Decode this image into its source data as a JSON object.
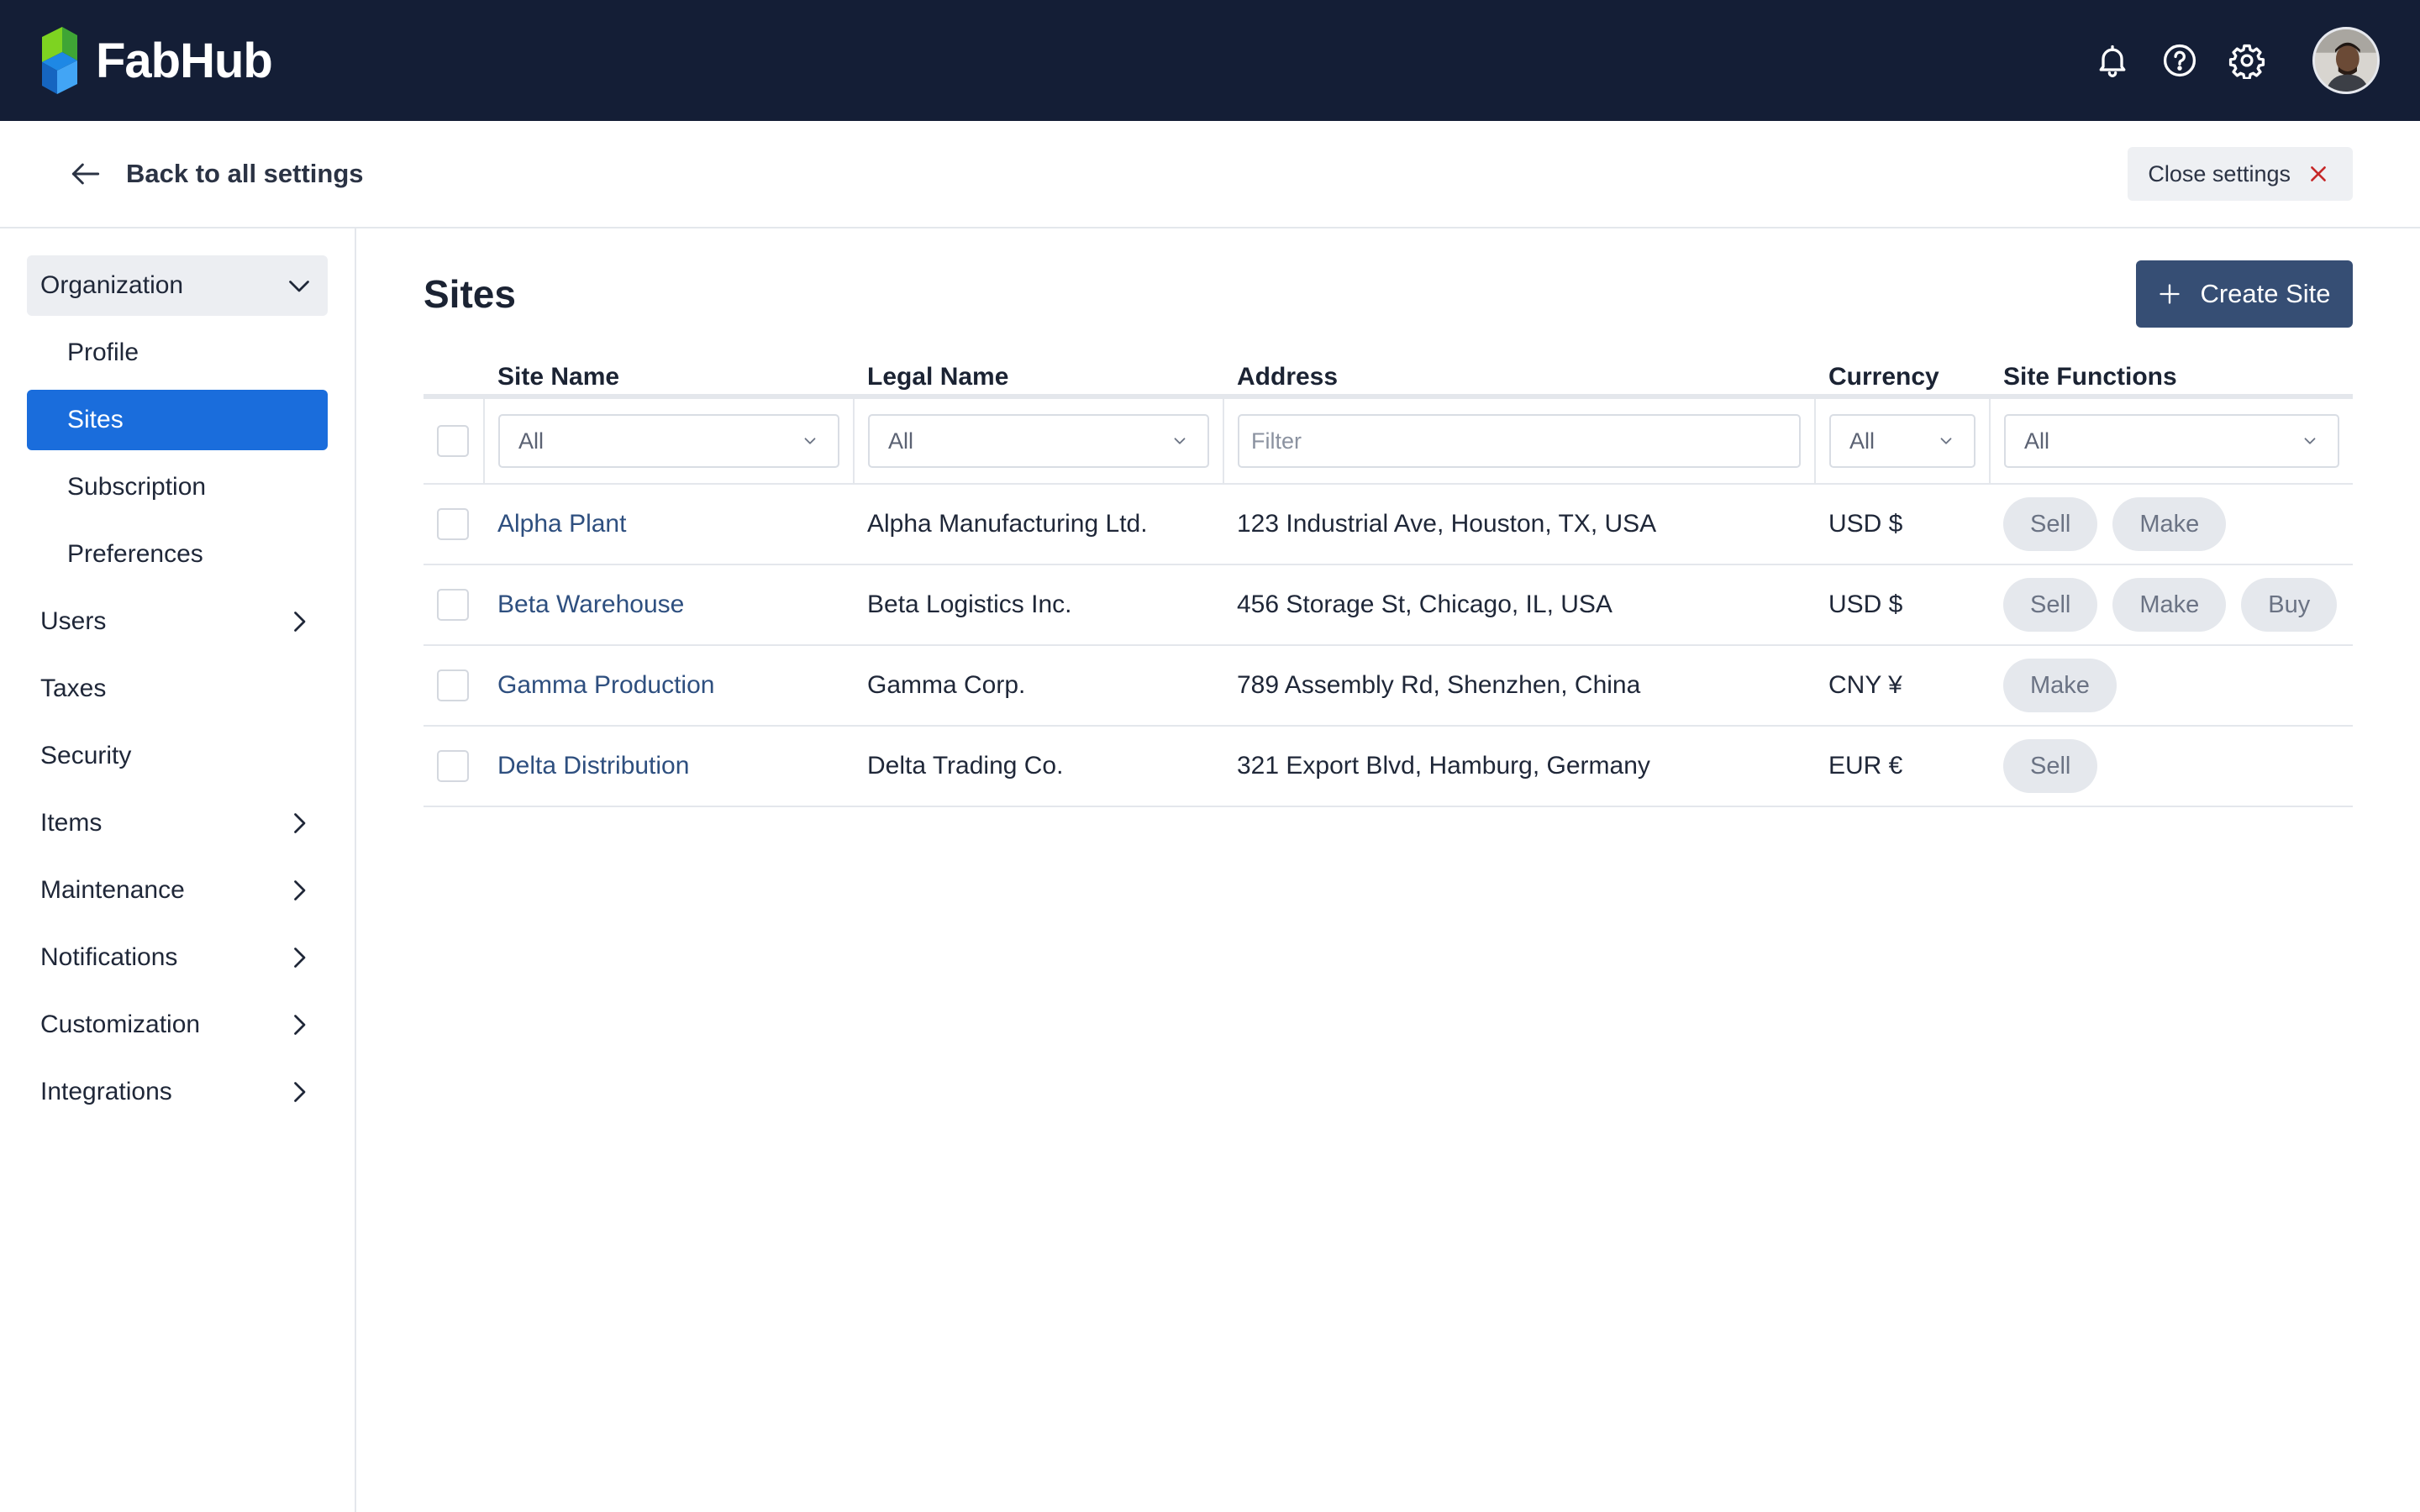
{
  "app": {
    "name": "FabHub"
  },
  "topbar": {
    "icons": [
      "bell-icon",
      "help-icon",
      "gear-icon"
    ],
    "avatar": "user-avatar"
  },
  "subheader": {
    "back_label": "Back to all settings",
    "close_label": "Close settings"
  },
  "sidebar": {
    "items": [
      {
        "label": "Organization",
        "type": "group",
        "chevron": "down"
      },
      {
        "label": "Profile",
        "type": "sub"
      },
      {
        "label": "Sites",
        "type": "sub",
        "active": true
      },
      {
        "label": "Subscription",
        "type": "sub"
      },
      {
        "label": "Preferences",
        "type": "sub"
      },
      {
        "label": "Users",
        "chevron": "right"
      },
      {
        "label": "Taxes"
      },
      {
        "label": "Security"
      },
      {
        "label": "Items",
        "chevron": "right"
      },
      {
        "label": "Maintenance",
        "chevron": "right"
      },
      {
        "label": "Notifications",
        "chevron": "right"
      },
      {
        "label": "Customization",
        "chevron": "right"
      },
      {
        "label": "Integrations",
        "chevron": "right"
      }
    ]
  },
  "main": {
    "title": "Sites",
    "create_label": "Create Site",
    "columns": [
      "Site Name",
      "Legal Name",
      "Address",
      "Currency",
      "Site Functions"
    ],
    "filters": {
      "site_name": "All",
      "legal_name": "All",
      "address_placeholder": "Filter",
      "currency": "All",
      "site_functions": "All"
    },
    "rows": [
      {
        "site_name": "Alpha Plant",
        "legal_name": "Alpha Manufacturing Ltd.",
        "address": "123 Industrial Ave, Houston, TX, USA",
        "currency": "USD $",
        "functions": [
          "Sell",
          "Make"
        ]
      },
      {
        "site_name": "Beta Warehouse",
        "legal_name": "Beta Logistics Inc.",
        "address": "456 Storage St, Chicago, IL, USA",
        "currency": "USD $",
        "functions": [
          "Sell",
          "Make",
          "Buy"
        ]
      },
      {
        "site_name": "Gamma Production",
        "legal_name": "Gamma Corp.",
        "address": "789 Assembly Rd, Shenzhen, China",
        "currency": "CNY ¥",
        "functions": [
          "Make"
        ]
      },
      {
        "site_name": "Delta Distribution",
        "legal_name": "Delta Trading Co.",
        "address": "321 Export Blvd, Hamburg, Germany",
        "currency": "EUR €",
        "functions": [
          "Sell"
        ]
      }
    ]
  },
  "colors": {
    "topbar_bg": "#141e36",
    "active_nav": "#1a6ddc",
    "primary_button": "#364e74",
    "link": "#2e4f7f"
  }
}
